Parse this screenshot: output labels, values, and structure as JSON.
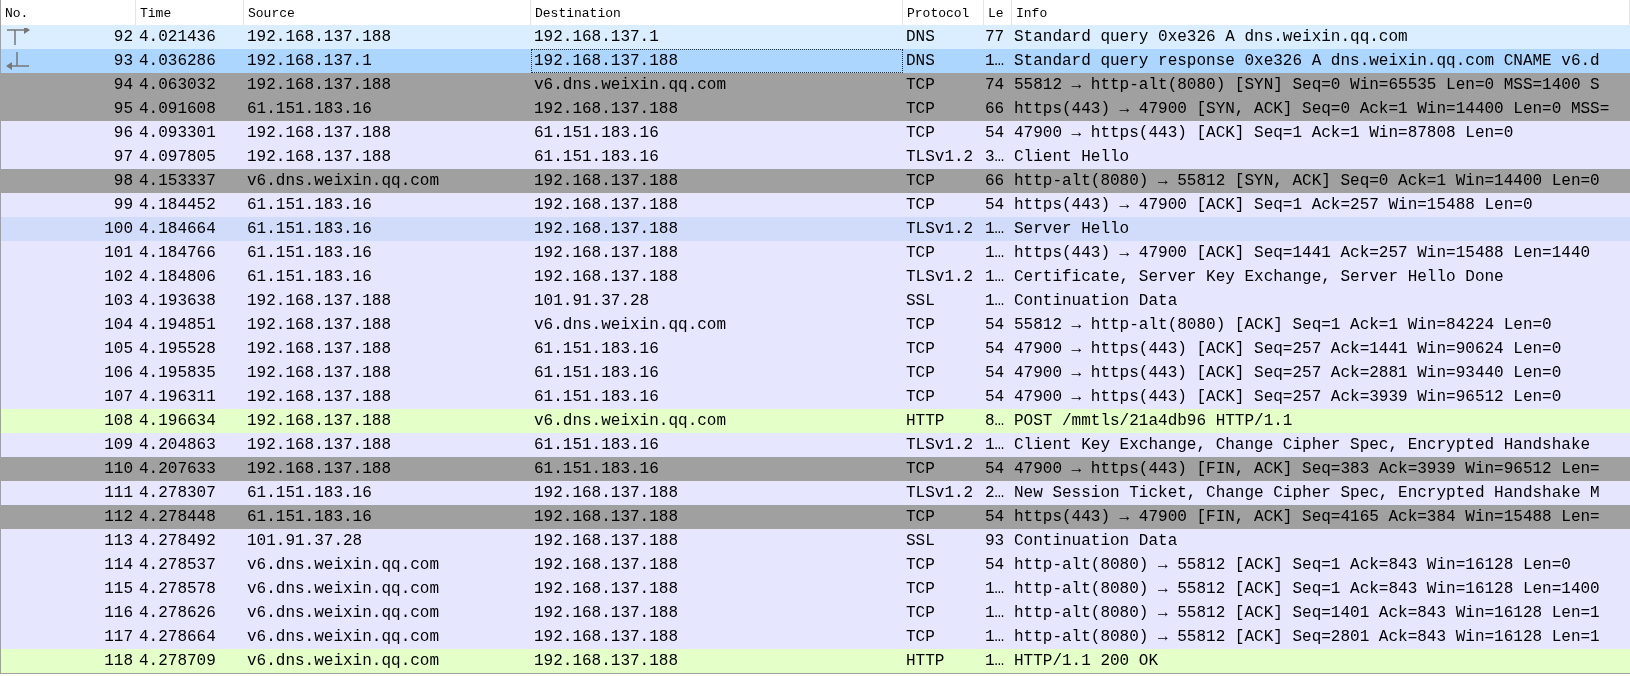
{
  "columns": [
    "No.",
    "Time",
    "Source",
    "Destination",
    "Protocol",
    "Le",
    "Info"
  ],
  "rows": [
    {
      "no": "92",
      "time": "4.021436",
      "source": "192.168.137.188",
      "destination": "192.168.137.1",
      "protocol": "DNS",
      "length": "77",
      "info": "Standard query 0xe326 A dns.weixin.qq.com",
      "color": "#daeeff",
      "selected": false,
      "kind": "request"
    },
    {
      "no": "93",
      "time": "4.036286",
      "source": "192.168.137.1",
      "destination": "192.168.137.188",
      "protocol": "DNS",
      "length": "1…",
      "info": "Standard query response 0xe326 A dns.weixin.qq.com CNAME v6.d",
      "color": "#acd6fe",
      "selected": true,
      "kind": "response"
    },
    {
      "no": "94",
      "time": "4.063032",
      "source": "192.168.137.188",
      "destination": "v6.dns.weixin.qq.com",
      "protocol": "TCP",
      "length": "74",
      "info": "55812 → http-alt(8080) [SYN] Seq=0 Win=65535 Len=0 MSS=1400 S",
      "color": "#a0a0a0",
      "selected": false
    },
    {
      "no": "95",
      "time": "4.091608",
      "source": "61.151.183.16",
      "destination": "192.168.137.188",
      "protocol": "TCP",
      "length": "66",
      "info": "https(443) → 47900 [SYN, ACK] Seq=0 Ack=1 Win=14400 Len=0 MSS=",
      "color": "#a0a0a0",
      "selected": false
    },
    {
      "no": "96",
      "time": "4.093301",
      "source": "192.168.137.188",
      "destination": "61.151.183.16",
      "protocol": "TCP",
      "length": "54",
      "info": "47900 → https(443) [ACK] Seq=1 Ack=1 Win=87808 Len=0",
      "color": "#e7e6ff",
      "selected": false
    },
    {
      "no": "97",
      "time": "4.097805",
      "source": "192.168.137.188",
      "destination": "61.151.183.16",
      "protocol": "TLSv1.2",
      "length": "3…",
      "info": "Client Hello",
      "color": "#e7e6ff",
      "selected": false
    },
    {
      "no": "98",
      "time": "4.153337",
      "source": "v6.dns.weixin.qq.com",
      "destination": "192.168.137.188",
      "protocol": "TCP",
      "length": "66",
      "info": "http-alt(8080) → 55812 [SYN, ACK] Seq=0 Ack=1 Win=14400 Len=0",
      "color": "#a0a0a0",
      "selected": false
    },
    {
      "no": "99",
      "time": "4.184452",
      "source": "61.151.183.16",
      "destination": "192.168.137.188",
      "protocol": "TCP",
      "length": "54",
      "info": "https(443) → 47900 [ACK] Seq=1 Ack=257 Win=15488 Len=0",
      "color": "#e7e6ff",
      "selected": false
    },
    {
      "no": "100",
      "time": "4.184664",
      "source": "61.151.183.16",
      "destination": "192.168.137.188",
      "protocol": "TLSv1.2",
      "length": "1…",
      "info": "Server Hello",
      "color": "#d0dcfa",
      "selected": false
    },
    {
      "no": "101",
      "time": "4.184766",
      "source": "61.151.183.16",
      "destination": "192.168.137.188",
      "protocol": "TCP",
      "length": "1…",
      "info": "https(443) → 47900 [ACK] Seq=1441 Ack=257 Win=15488 Len=1440",
      "color": "#e7e6ff",
      "selected": false
    },
    {
      "no": "102",
      "time": "4.184806",
      "source": "61.151.183.16",
      "destination": "192.168.137.188",
      "protocol": "TLSv1.2",
      "length": "1…",
      "info": "Certificate, Server Key Exchange, Server Hello Done",
      "color": "#e7e6ff",
      "selected": false
    },
    {
      "no": "103",
      "time": "4.193638",
      "source": "192.168.137.188",
      "destination": "101.91.37.28",
      "protocol": "SSL",
      "length": "1…",
      "info": "Continuation Data",
      "color": "#e7e6ff",
      "selected": false
    },
    {
      "no": "104",
      "time": "4.194851",
      "source": "192.168.137.188",
      "destination": "v6.dns.weixin.qq.com",
      "protocol": "TCP",
      "length": "54",
      "info": "55812 → http-alt(8080) [ACK] Seq=1 Ack=1 Win=84224 Len=0",
      "color": "#e7e6ff",
      "selected": false
    },
    {
      "no": "105",
      "time": "4.195528",
      "source": "192.168.137.188",
      "destination": "61.151.183.16",
      "protocol": "TCP",
      "length": "54",
      "info": "47900 → https(443) [ACK] Seq=257 Ack=1441 Win=90624 Len=0",
      "color": "#e7e6ff",
      "selected": false
    },
    {
      "no": "106",
      "time": "4.195835",
      "source": "192.168.137.188",
      "destination": "61.151.183.16",
      "protocol": "TCP",
      "length": "54",
      "info": "47900 → https(443) [ACK] Seq=257 Ack=2881 Win=93440 Len=0",
      "color": "#e7e6ff",
      "selected": false
    },
    {
      "no": "107",
      "time": "4.196311",
      "source": "192.168.137.188",
      "destination": "61.151.183.16",
      "protocol": "TCP",
      "length": "54",
      "info": "47900 → https(443) [ACK] Seq=257 Ack=3939 Win=96512 Len=0",
      "color": "#e7e6ff",
      "selected": false
    },
    {
      "no": "108",
      "time": "4.196634",
      "source": "192.168.137.188",
      "destination": "v6.dns.weixin.qq.com",
      "protocol": "HTTP",
      "length": "8…",
      "info": "POST /mmtls/21a4db96 HTTP/1.1",
      "color": "#e4ffc7",
      "selected": false
    },
    {
      "no": "109",
      "time": "4.204863",
      "source": "192.168.137.188",
      "destination": "61.151.183.16",
      "protocol": "TLSv1.2",
      "length": "1…",
      "info": "Client Key Exchange, Change Cipher Spec, Encrypted Handshake",
      "color": "#e7e6ff",
      "selected": false
    },
    {
      "no": "110",
      "time": "4.207633",
      "source": "192.168.137.188",
      "destination": "61.151.183.16",
      "protocol": "TCP",
      "length": "54",
      "info": "47900 → https(443) [FIN, ACK] Seq=383 Ack=3939 Win=96512 Len=",
      "color": "#a0a0a0",
      "selected": false
    },
    {
      "no": "111",
      "time": "4.278307",
      "source": "61.151.183.16",
      "destination": "192.168.137.188",
      "protocol": "TLSv1.2",
      "length": "2…",
      "info": "New Session Ticket, Change Cipher Spec, Encrypted Handshake M",
      "color": "#e7e6ff",
      "selected": false
    },
    {
      "no": "112",
      "time": "4.278448",
      "source": "61.151.183.16",
      "destination": "192.168.137.188",
      "protocol": "TCP",
      "length": "54",
      "info": "https(443) → 47900 [FIN, ACK] Seq=4165 Ack=384 Win=15488 Len=",
      "color": "#a0a0a0",
      "selected": false
    },
    {
      "no": "113",
      "time": "4.278492",
      "source": "101.91.37.28",
      "destination": "192.168.137.188",
      "protocol": "SSL",
      "length": "93",
      "info": "Continuation Data",
      "color": "#e7e6ff",
      "selected": false
    },
    {
      "no": "114",
      "time": "4.278537",
      "source": "v6.dns.weixin.qq.com",
      "destination": "192.168.137.188",
      "protocol": "TCP",
      "length": "54",
      "info": "http-alt(8080) → 55812 [ACK] Seq=1 Ack=843 Win=16128 Len=0",
      "color": "#e7e6ff",
      "selected": false
    },
    {
      "no": "115",
      "time": "4.278578",
      "source": "v6.dns.weixin.qq.com",
      "destination": "192.168.137.188",
      "protocol": "TCP",
      "length": "1…",
      "info": "http-alt(8080) → 55812 [ACK] Seq=1 Ack=843 Win=16128 Len=1400",
      "color": "#e7e6ff",
      "selected": false
    },
    {
      "no": "116",
      "time": "4.278626",
      "source": "v6.dns.weixin.qq.com",
      "destination": "192.168.137.188",
      "protocol": "TCP",
      "length": "1…",
      "info": "http-alt(8080) → 55812 [ACK] Seq=1401 Ack=843 Win=16128 Len=1",
      "color": "#e7e6ff",
      "selected": false
    },
    {
      "no": "117",
      "time": "4.278664",
      "source": "v6.dns.weixin.qq.com",
      "destination": "192.168.137.188",
      "protocol": "TCP",
      "length": "1…",
      "info": "http-alt(8080) → 55812 [ACK] Seq=2801 Ack=843 Win=16128 Len=1",
      "color": "#e7e6ff",
      "selected": false
    },
    {
      "no": "118",
      "time": "4.278709",
      "source": "v6.dns.weixin.qq.com",
      "destination": "192.168.137.188",
      "protocol": "HTTP",
      "length": "1…",
      "info": "HTTP/1.1 200 OK",
      "color": "#e4ffc7",
      "selected": false
    }
  ]
}
